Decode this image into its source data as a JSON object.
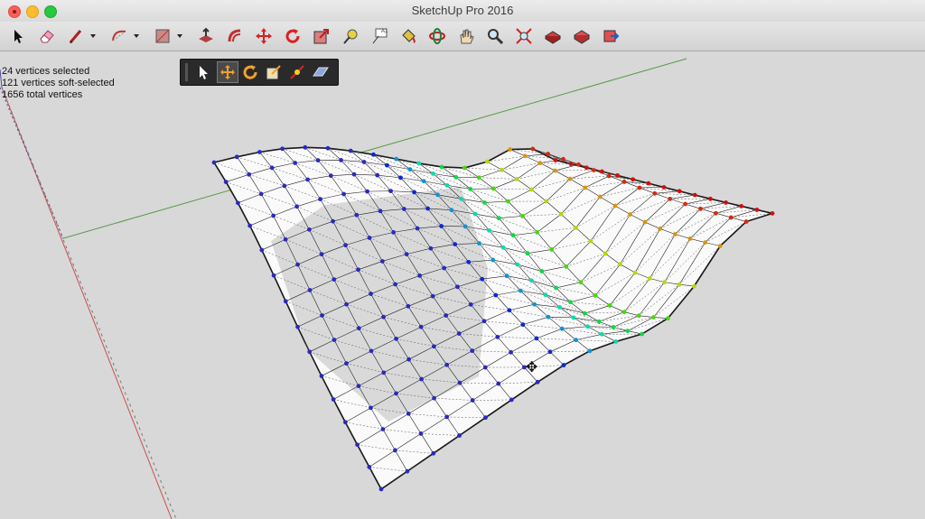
{
  "window": {
    "title": "SketchUp Pro 2016"
  },
  "toolbar": {
    "tools": [
      {
        "name": "select-icon"
      },
      {
        "name": "eraser-icon"
      },
      {
        "name": "line-icon"
      },
      {
        "name": "arc-icon"
      },
      {
        "name": "rectangle-icon"
      },
      {
        "name": "push-pull-icon"
      },
      {
        "name": "offset-icon"
      },
      {
        "name": "move-icon"
      },
      {
        "name": "rotate-icon"
      },
      {
        "name": "scale-icon"
      },
      {
        "name": "tape-measure-icon"
      },
      {
        "name": "text-icon"
      },
      {
        "name": "paint-bucket-icon"
      },
      {
        "name": "orbit-icon"
      },
      {
        "name": "pan-icon"
      },
      {
        "name": "zoom-icon"
      },
      {
        "name": "zoom-extents-icon"
      },
      {
        "name": "warehouse-icon"
      },
      {
        "name": "extension-warehouse-icon"
      },
      {
        "name": "share-model-icon"
      }
    ],
    "text_tool_label": "A1"
  },
  "status": {
    "selected": "24 vertices selected",
    "soft_selected": "121 vertices soft-selected",
    "total": "1656 total vertices"
  },
  "vertex_tools": {
    "tools": [
      {
        "name": "select-vertex-icon"
      },
      {
        "name": "vertex-move-icon",
        "active": true
      },
      {
        "name": "vertex-rotate-icon"
      },
      {
        "name": "vertex-scale-icon"
      },
      {
        "name": "soft-selection-icon"
      },
      {
        "name": "plane-icon"
      }
    ]
  },
  "colors": {
    "viewport": "#d8d8d8",
    "green_axis": "#5a9a4a",
    "red_axis": "#c85050",
    "blue_axis": "#4a4aa0",
    "vertex_selected": "#2a2ac0",
    "mesh_edge": "#111111"
  }
}
